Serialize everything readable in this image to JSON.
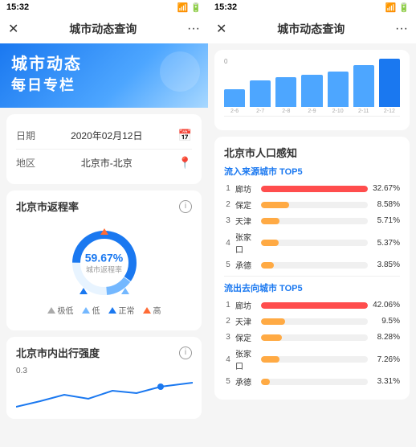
{
  "left_panel": {
    "status_bar": {
      "time": "15:32",
      "icons": "📶 🔋"
    },
    "nav": {
      "title": "城市动态查询",
      "close_label": "✕",
      "more_label": "···"
    },
    "hero": {
      "line1": "城市动态",
      "line2": "每日专栏"
    },
    "date_row": {
      "label": "日期",
      "value": "2020年02月12日",
      "icon": "📅"
    },
    "region_row": {
      "label": "地区",
      "value": "北京市-北京",
      "icon": "📍"
    },
    "return_rate_card": {
      "title": "北京市返程率",
      "percent": "59.67%",
      "sub_label": "城市返程率",
      "info": "ℹ"
    },
    "legend": [
      {
        "label": "极低",
        "color": "#aaa"
      },
      {
        "label": "低",
        "color": "#74b8ff"
      },
      {
        "label": "正常",
        "color": "#1a78f0"
      },
      {
        "label": "高",
        "color": "#ff6b35"
      }
    ],
    "mobility_card": {
      "title": "北京市内出行强度",
      "value": "0.3",
      "info": "ℹ"
    }
  },
  "right_panel": {
    "status_bar": {
      "time": "15:32"
    },
    "nav": {
      "title": "城市动态查询",
      "close_label": "✕",
      "more_label": "···"
    },
    "bar_chart": {
      "y_axis": [
        "0"
      ],
      "x_labels": [
        "2-6",
        "2-7",
        "2-8",
        "2-9",
        "2-10",
        "2-11",
        "2-12"
      ],
      "bars": [
        30,
        45,
        50,
        55,
        60,
        72,
        82
      ]
    },
    "population_card": {
      "title": "北京市人口感知",
      "inflow_section": "流入来源城市 TOP5",
      "inflow_items": [
        {
          "rank": "1",
          "city": "廊坊",
          "pct": "32.67%",
          "ratio": 1.0,
          "color": "#ff4d4d"
        },
        {
          "rank": "2",
          "city": "保定",
          "pct": "8.58%",
          "ratio": 0.26,
          "color": "#ffaa44"
        },
        {
          "rank": "3",
          "city": "天津",
          "pct": "5.71%",
          "ratio": 0.175,
          "color": "#ffaa44"
        },
        {
          "rank": "4",
          "city": "张家口",
          "pct": "5.37%",
          "ratio": 0.164,
          "color": "#ffaa44"
        },
        {
          "rank": "5",
          "city": "承德",
          "pct": "3.85%",
          "ratio": 0.118,
          "color": "#ffaa44"
        }
      ],
      "outflow_section": "流出去向城市 TOP5",
      "outflow_items": [
        {
          "rank": "1",
          "city": "廊坊",
          "pct": "42.06%",
          "ratio": 1.0,
          "color": "#ff4d4d"
        },
        {
          "rank": "2",
          "city": "天津",
          "pct": "9.5%",
          "ratio": 0.226,
          "color": "#ffaa44"
        },
        {
          "rank": "3",
          "city": "保定",
          "pct": "8.28%",
          "ratio": 0.197,
          "color": "#ffaa44"
        },
        {
          "rank": "4",
          "city": "张家口",
          "pct": "7.26%",
          "ratio": 0.172,
          "color": "#ffaa44"
        },
        {
          "rank": "5",
          "city": "承德",
          "pct": "3.31%",
          "ratio": 0.079,
          "color": "#ffaa44"
        }
      ]
    }
  }
}
